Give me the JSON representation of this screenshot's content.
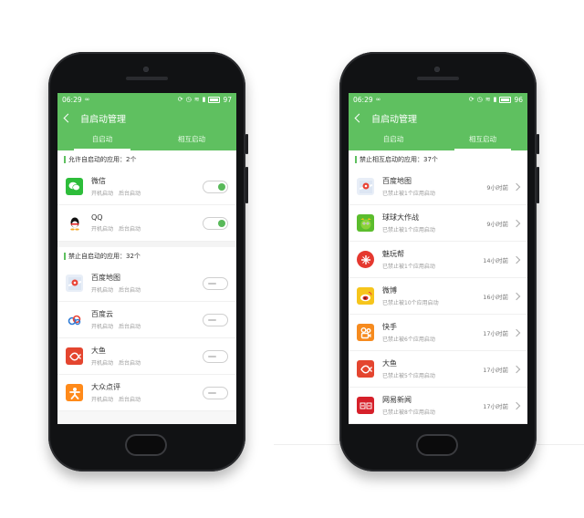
{
  "left_phone": {
    "status": {
      "time": "06:29",
      "battery": "97"
    },
    "title": "自启动管理",
    "tabs": [
      {
        "label": "自启动",
        "active": true
      },
      {
        "label": "相互启动",
        "active": false
      }
    ],
    "allowed_header": "允许自启动的应用：2个",
    "allowed_apps": [
      {
        "name": "微信",
        "sub": "开机启动　后台启动",
        "icon": "wechat-icon",
        "color": "#2dbd3a",
        "enabled": true
      },
      {
        "name": "QQ",
        "sub": "开机启动　后台启动",
        "icon": "qq-icon",
        "color": "#ffffff",
        "enabled": true
      }
    ],
    "blocked_header": "禁止自启动的应用：32个",
    "blocked_apps": [
      {
        "name": "百度地图",
        "sub": "开机启动　后台启动",
        "icon": "baidu-map-icon",
        "color": "#e8eef7",
        "enabled": false
      },
      {
        "name": "百度云",
        "sub": "开机启动　后台启动",
        "icon": "baidu-cloud-icon",
        "color": "#ffffff",
        "enabled": false
      },
      {
        "name": "大鱼",
        "sub": "开机启动　后台启动",
        "icon": "dayu-icon",
        "color": "#e4452f",
        "enabled": false
      },
      {
        "name": "大众点评",
        "sub": "开机启动　后台启动",
        "icon": "dianping-icon",
        "color": "#ff8a1a",
        "enabled": false
      }
    ]
  },
  "right_phone": {
    "status": {
      "time": "06:29",
      "battery": "96"
    },
    "title": "自启动管理",
    "tabs": [
      {
        "label": "自启动",
        "active": false
      },
      {
        "label": "相互启动",
        "active": true
      }
    ],
    "blocked_header": "禁止相互启动的应用：37个",
    "apps": [
      {
        "name": "百度地图",
        "sub": "已禁止被1个应用启动",
        "time": "9小时前",
        "icon": "baidu-map-icon",
        "color": "#e8eef7"
      },
      {
        "name": "球球大作战",
        "sub": "已禁止被1个应用启动",
        "time": "9小时前",
        "icon": "ballbattle-icon",
        "color": "#5bbd2d"
      },
      {
        "name": "魅玩帮",
        "sub": "已禁止被1个应用启动",
        "time": "14小时前",
        "icon": "meiwan-icon",
        "color": "#e5382f"
      },
      {
        "name": "微博",
        "sub": "已禁止被10个应用启动",
        "time": "16小时前",
        "icon": "weibo-icon",
        "color": "#f6c51c"
      },
      {
        "name": "快手",
        "sub": "已禁止被6个应用启动",
        "time": "17小时前",
        "icon": "kuaishou-icon",
        "color": "#f68b1f"
      },
      {
        "name": "大鱼",
        "sub": "已禁止被5个应用启动",
        "time": "17小时前",
        "icon": "dayu-icon",
        "color": "#e4452f"
      },
      {
        "name": "网易新闻",
        "sub": "已禁止被8个应用启动",
        "time": "17小时前",
        "icon": "netease-news-icon",
        "color": "#d6202a"
      }
    ]
  }
}
